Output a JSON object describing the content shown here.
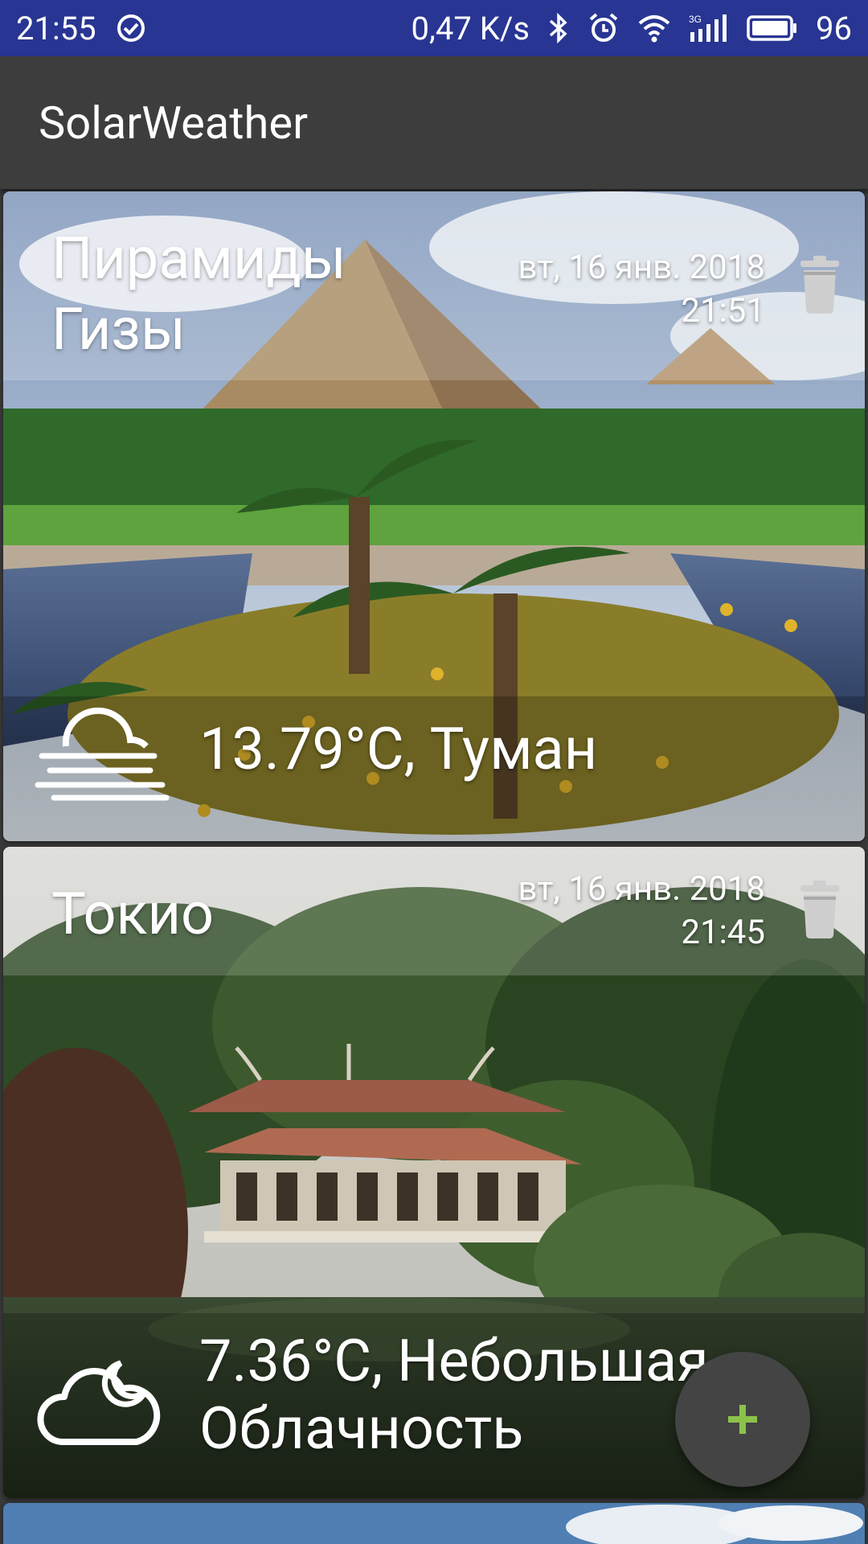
{
  "status_bar": {
    "time": "21:55",
    "network_speed": "0,47 K/s",
    "battery": "96",
    "icons": [
      "check-circle-icon",
      "bluetooth-icon",
      "alarm-icon",
      "wifi-icon",
      "signal-3g-icon",
      "battery-icon"
    ]
  },
  "app": {
    "title": "SolarWeather"
  },
  "cards": [
    {
      "city": "Пирамиды Гизы",
      "date_line": "вт, 16 янв. 2018",
      "time_line": "21:51",
      "weather": "13.79°C, Туман",
      "weather_icon": "fog-icon",
      "delete_icon": "trash-icon"
    },
    {
      "city": "Токио",
      "date_line": "вт, 16 янв. 2018",
      "time_line": "21:45",
      "weather_line1": "7.36°C, Небольшая",
      "weather_line2": "Облачность",
      "weather_icon": "partly-cloudy-night-icon",
      "delete_icon": "trash-icon"
    }
  ],
  "fab": {
    "icon": "plus-icon",
    "color": "#8bc34a"
  }
}
